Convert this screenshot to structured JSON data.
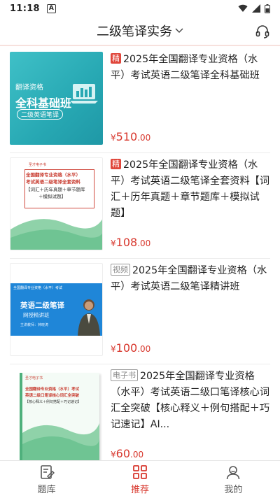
{
  "status_bar": {
    "time": "11:18",
    "notif_letter": "A"
  },
  "header": {
    "title": "二级笔译实务",
    "service_icon": "headset-icon"
  },
  "colors": {
    "accent": "#d8382e",
    "tag_red": "#e0463b"
  },
  "items": [
    {
      "tag": "精",
      "tag_style": "red",
      "title": "2025年全国翻译专业资格（水平）考试英语二级笔译全科基础班",
      "price_currency": "¥",
      "price_int": "510",
      "price_dec": ".00",
      "thumb": {
        "line1": "翻译资格",
        "line2": "全科基础班",
        "line3": "二级英语笔译"
      }
    },
    {
      "tag": "精",
      "tag_style": "red",
      "title": "2025年全国翻译专业资格（水平）考试英语二级笔译全套资料【词汇＋历年真题＋章节题库＋模拟试题】",
      "price_currency": "¥",
      "price_int": "108",
      "price_dec": ".00",
      "thumb": {
        "brand": "圣才电子书",
        "line1": "全国翻译专业资格（水平）",
        "line2": "考试英语二级笔译全套资料",
        "line3": "【词汇＋历年真题＋章节题库",
        "line4": "＋模拟试题】"
      }
    },
    {
      "tag": "视频",
      "tag_style": "outline",
      "title": "2025年全国翻译专业资格（水平）考试英语二级笔译精讲班",
      "price_currency": "¥",
      "price_int": "100",
      "price_dec": ".00",
      "thumb": {
        "top": "全国翻译专业资格（水平）考试",
        "line1": "英语二级笔译",
        "line2": "网授精讲班",
        "line3": "主讲教师：钟晓涛"
      }
    },
    {
      "tag": "电子书",
      "tag_style": "outline",
      "title": "2025年全国翻译专业资格（水平）考试英语二级口笔译核心词汇全突破【核心释义＋例句搭配＋巧记速记】AI...",
      "price_currency": "¥",
      "price_int": "60",
      "price_dec": ".00",
      "thumb": {
        "brand": "圣才电子书",
        "line1": "全国翻译专业资格（水平）考试",
        "line2": "英语二级口笔译核心词汇全突破",
        "line3": "【核心释义＋例句搭配＋巧记速记】"
      }
    }
  ],
  "bottom_nav": [
    {
      "label": "题库",
      "icon": "question-bank-icon"
    },
    {
      "label": "推荐",
      "icon": "grid-icon",
      "active": true
    },
    {
      "label": "我的",
      "icon": "profile-icon"
    }
  ]
}
